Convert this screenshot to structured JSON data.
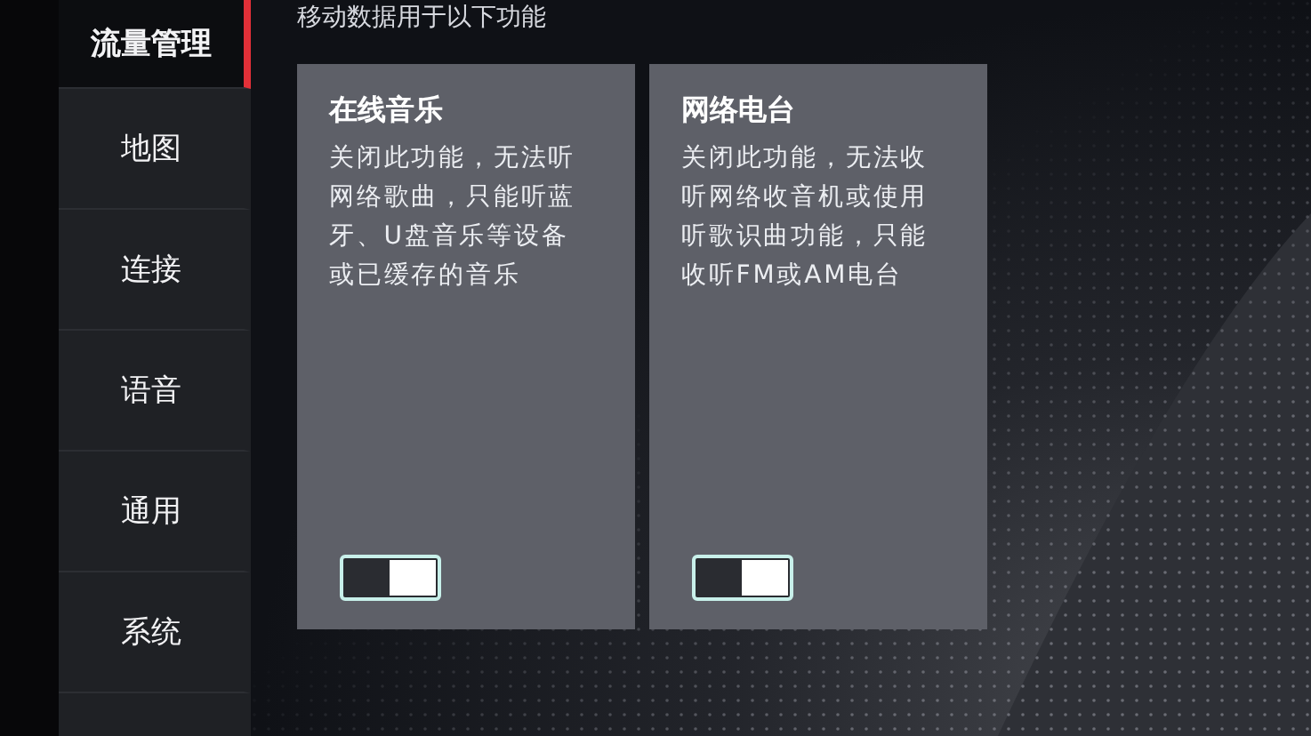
{
  "sidebar": {
    "items": [
      {
        "label": "流量管理",
        "selected": true
      },
      {
        "label": "地图",
        "selected": false
      },
      {
        "label": "连接",
        "selected": false
      },
      {
        "label": "语音",
        "selected": false
      },
      {
        "label": "通用",
        "selected": false
      },
      {
        "label": "系统",
        "selected": false
      }
    ]
  },
  "header": "移动数据用于以下功能",
  "cards": [
    {
      "title": "在线音乐",
      "description": "关闭此功能，无法听网络歌曲，只能听蓝牙、U盘音乐等设备或已缓存的音乐",
      "on": true
    },
    {
      "title": "网络电台",
      "description": "关闭此功能，无法收听网络收音机或使用听歌识曲功能，只能收听FM或AM电台",
      "on": true
    }
  ]
}
